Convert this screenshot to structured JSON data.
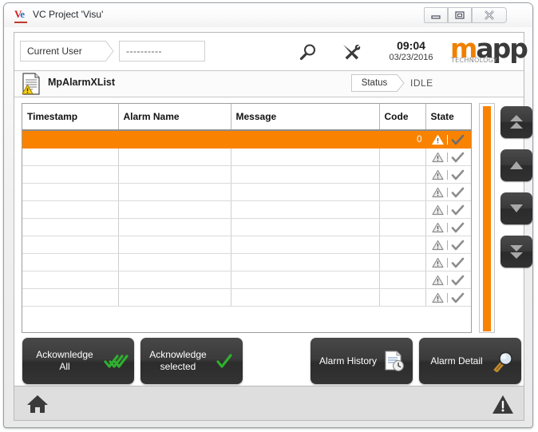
{
  "window": {
    "title": "VC Project 'Visu'",
    "icon": "vc-project-icon",
    "controls": {
      "minimize": "minimize-button",
      "maximize": "restore-button",
      "close": "close-button"
    }
  },
  "toolbar": {
    "user_label": "Current User",
    "user_value": "----------",
    "search_icon": "magnifier-icon",
    "tools_icon": "tools-icon",
    "time": "09:04",
    "date": "03/23/2016",
    "logo": {
      "main_m": "m",
      "main_rest": "app",
      "sub": "TECHNOLOGY"
    }
  },
  "statusstrip": {
    "doc_icon": "document-warning-icon",
    "module": "MpAlarmXList",
    "status_label": "Status",
    "status_value": "IDLE"
  },
  "table": {
    "columns": [
      "Timestamp",
      "Alarm Name",
      "Message",
      "Code",
      "State"
    ],
    "rows": [
      {
        "timestamp": "",
        "alarm_name": "",
        "message": "",
        "code": "0",
        "state": "inactive-acknowledged",
        "selected": true
      },
      {
        "timestamp": "",
        "alarm_name": "",
        "message": "",
        "code": "",
        "state": "inactive-acknowledged",
        "selected": false
      },
      {
        "timestamp": "",
        "alarm_name": "",
        "message": "",
        "code": "",
        "state": "inactive-acknowledged",
        "selected": false
      },
      {
        "timestamp": "",
        "alarm_name": "",
        "message": "",
        "code": "",
        "state": "inactive-acknowledged",
        "selected": false
      },
      {
        "timestamp": "",
        "alarm_name": "",
        "message": "",
        "code": "",
        "state": "inactive-acknowledged",
        "selected": false
      },
      {
        "timestamp": "",
        "alarm_name": "",
        "message": "",
        "code": "",
        "state": "inactive-acknowledged",
        "selected": false
      },
      {
        "timestamp": "",
        "alarm_name": "",
        "message": "",
        "code": "",
        "state": "inactive-acknowledged",
        "selected": false
      },
      {
        "timestamp": "",
        "alarm_name": "",
        "message": "",
        "code": "",
        "state": "inactive-acknowledged",
        "selected": false
      },
      {
        "timestamp": "",
        "alarm_name": "",
        "message": "",
        "code": "",
        "state": "inactive-acknowledged",
        "selected": false
      },
      {
        "timestamp": "",
        "alarm_name": "",
        "message": "",
        "code": "",
        "state": "inactive-acknowledged",
        "selected": false
      }
    ]
  },
  "navigation": {
    "first": "double-up-arrow-icon",
    "previous": "up-arrow-icon",
    "next": "down-arrow-icon",
    "last": "double-down-arrow-icon"
  },
  "actions": {
    "acknowledge_all": {
      "line1": "Ackownledge",
      "line2": "All",
      "icon": "triple-check-icon"
    },
    "acknowledge_selected": {
      "line1": "Acknowledge",
      "line2": "selected",
      "icon": "check-icon"
    },
    "alarm_history": {
      "line1": "Alarm History",
      "line2": "",
      "icon": "document-clock-icon"
    },
    "alarm_detail": {
      "line1": "Alarm Detail",
      "line2": "",
      "icon": "magnifier-icon"
    }
  },
  "bottombar": {
    "home": "home-icon",
    "warning": "warning-triangle-icon"
  },
  "colors": {
    "accent_orange": "#f98300",
    "logo_orange": "#f08000",
    "button_dark": "#343434",
    "check_green": "#2fae2f",
    "warning_yellow": "#f7d117"
  }
}
